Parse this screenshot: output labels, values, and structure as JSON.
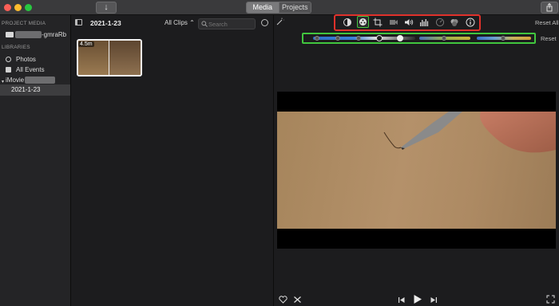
{
  "titlebar": {
    "tabs": [
      {
        "label": "Media",
        "active": true
      },
      {
        "label": "Projects",
        "active": false
      }
    ],
    "import_icon": "arrow-down-icon",
    "share_icon": "share-icon"
  },
  "sidebar": {
    "project_media_header": "PROJECT MEDIA",
    "project_item_suffix": "-gmraRb",
    "libraries_header": "LIBRARIES",
    "library_items": [
      "Photos",
      "All Events"
    ],
    "library_name": "iMovie",
    "event_item": "2021-1-23"
  },
  "browser": {
    "event_title": "2021-1-23",
    "filter_label": "All Clips ⌃",
    "search_placeholder": "Search",
    "clip_duration": "4.5m"
  },
  "viewer": {
    "reset_all_label": "Reset All",
    "reset_label": "Reset",
    "toolbar_icons": [
      "color-balance-icon",
      "color-correction-icon",
      "crop-icon",
      "stabilization-icon",
      "volume-icon",
      "noise-reduction-icon",
      "speed-icon",
      "clip-filter-icon",
      "info-icon"
    ],
    "selected_tool": "color-correction-icon"
  },
  "colors": {
    "highlight_red": "#e0312b",
    "highlight_green": "#41c63e"
  }
}
